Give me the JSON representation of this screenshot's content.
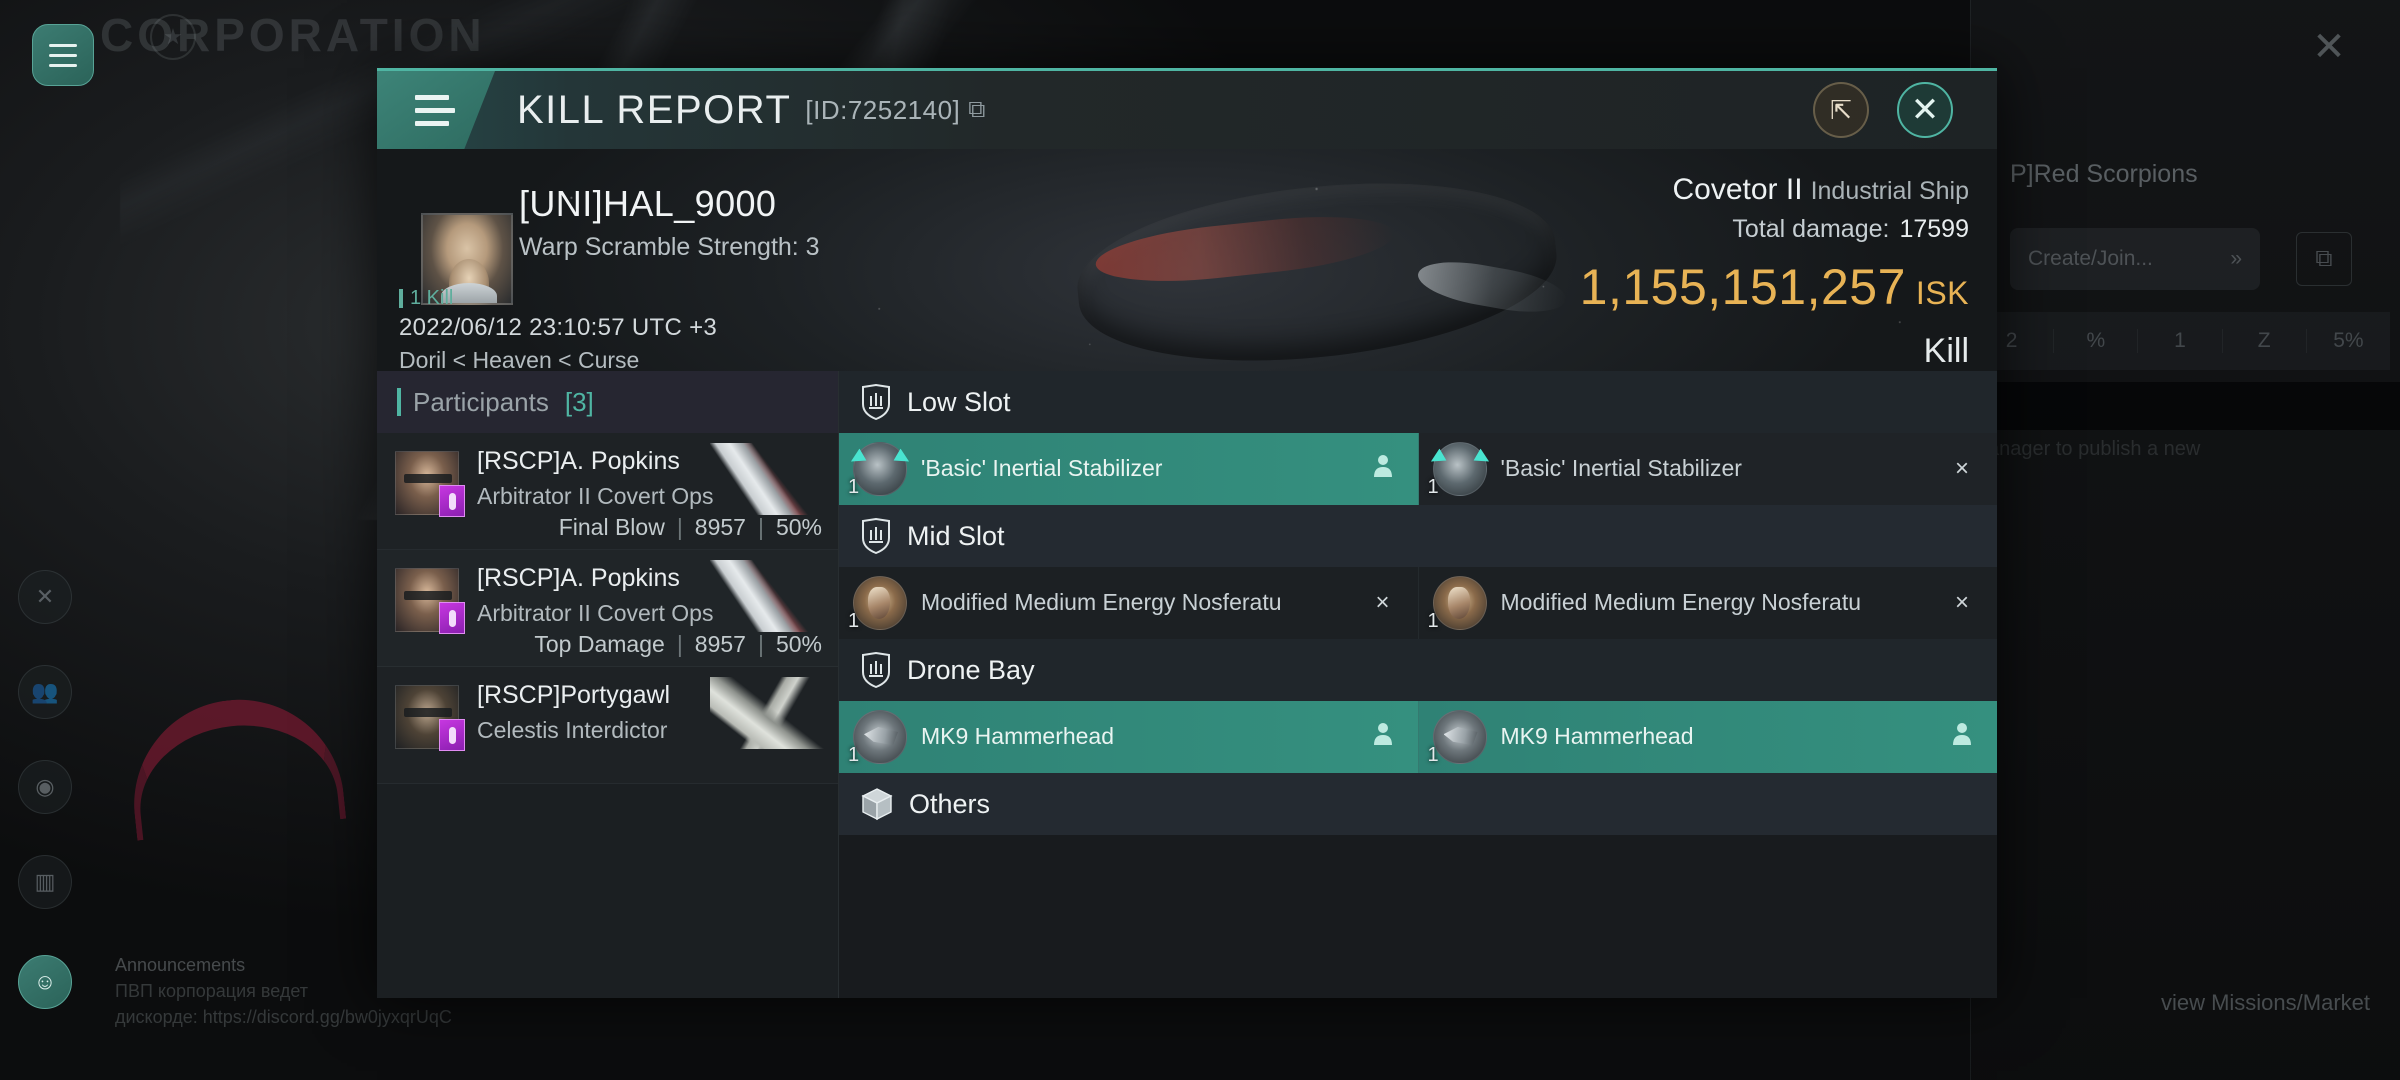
{
  "background": {
    "corp_title": "CORPORATION",
    "corp_name": "P]Red Scorpions",
    "create_join": "Create/Join...",
    "create_join_chevron": "»",
    "stats": [
      "2",
      "%",
      "1",
      "Z",
      "5%"
    ],
    "publish_hint": "anager to publish a new",
    "missions_market": "view Missions/Market",
    "announce_title": "Announcements",
    "announce_line1": "ПВП корпорация ведет",
    "announce_line2": "дискорде: https://discord.gg/bw0jyxqrUqC"
  },
  "titlebar": {
    "title": "KILL REPORT",
    "id": "[ID:7252140]",
    "copy_icon": "copy-icon",
    "share_icon": "external-link-icon",
    "close_icon": "close-icon",
    "menu_icon": "hamburger-icon"
  },
  "hero": {
    "victim_name": "[UNI]HAL_9000",
    "warp_scramble": "Warp Scramble Strength: 3",
    "kill_badge": "1 Kill",
    "timestamp": "2022/06/12 23:10:57 UTC +3",
    "location": "Doril < Heaven < Curse",
    "ship_name": "Covetor II",
    "ship_class": "Industrial Ship",
    "total_damage_label": "Total damage:",
    "total_damage_value": "17599",
    "isk_value": "1,155,151,257",
    "isk_unit": "ISK",
    "result": "Kill",
    "isk_color": "#e8b355",
    "accent_color": "#4fb5a3"
  },
  "participants": {
    "header_label": "Participants",
    "count": "[3]",
    "rows": [
      {
        "name": "[RSCP]A. Popkins",
        "ship": "Arbitrator II Covert Ops",
        "role": "Final Blow",
        "damage": "8957",
        "percent": "50%",
        "sep": "|"
      },
      {
        "name": "[RSCP]A. Popkins",
        "ship": "Arbitrator II Covert Ops",
        "role": "Top Damage",
        "damage": "8957",
        "percent": "50%",
        "sep": "|"
      },
      {
        "name": "[RSCP]Portygawl",
        "ship": "Celestis Interdictor",
        "role": "",
        "damage": "",
        "percent": "",
        "sep": ""
      }
    ]
  },
  "fitting": {
    "sections": [
      {
        "label": "Low Slot",
        "icon": "shield-slot-icon",
        "modules": [
          {
            "qty": "1",
            "name": "'Basic' Inertial Stabilizer",
            "state": "dropped",
            "state_glyph": "person",
            "highlight": true
          },
          {
            "qty": "1",
            "name": "'Basic' Inertial Stabilizer",
            "state": "destroyed",
            "state_glyph": "×",
            "highlight": false
          }
        ]
      },
      {
        "label": "Mid Slot",
        "icon": "shield-slot-icon",
        "modules": [
          {
            "qty": "1",
            "name": "Modified Medium Energy Nosferatu",
            "state": "destroyed",
            "state_glyph": "×",
            "highlight": false
          },
          {
            "qty": "1",
            "name": "Modified Medium Energy Nosferatu",
            "state": "destroyed",
            "state_glyph": "×",
            "highlight": false
          }
        ]
      },
      {
        "label": "Drone Bay",
        "icon": "shield-slot-icon",
        "modules": [
          {
            "qty": "1",
            "name": "MK9  Hammerhead",
            "state": "dropped",
            "state_glyph": "person",
            "highlight": true
          },
          {
            "qty": "1",
            "name": "MK9  Hammerhead",
            "state": "dropped",
            "state_glyph": "person",
            "highlight": true
          }
        ]
      },
      {
        "label": "Others",
        "icon": "cube-icon",
        "modules": []
      }
    ]
  }
}
